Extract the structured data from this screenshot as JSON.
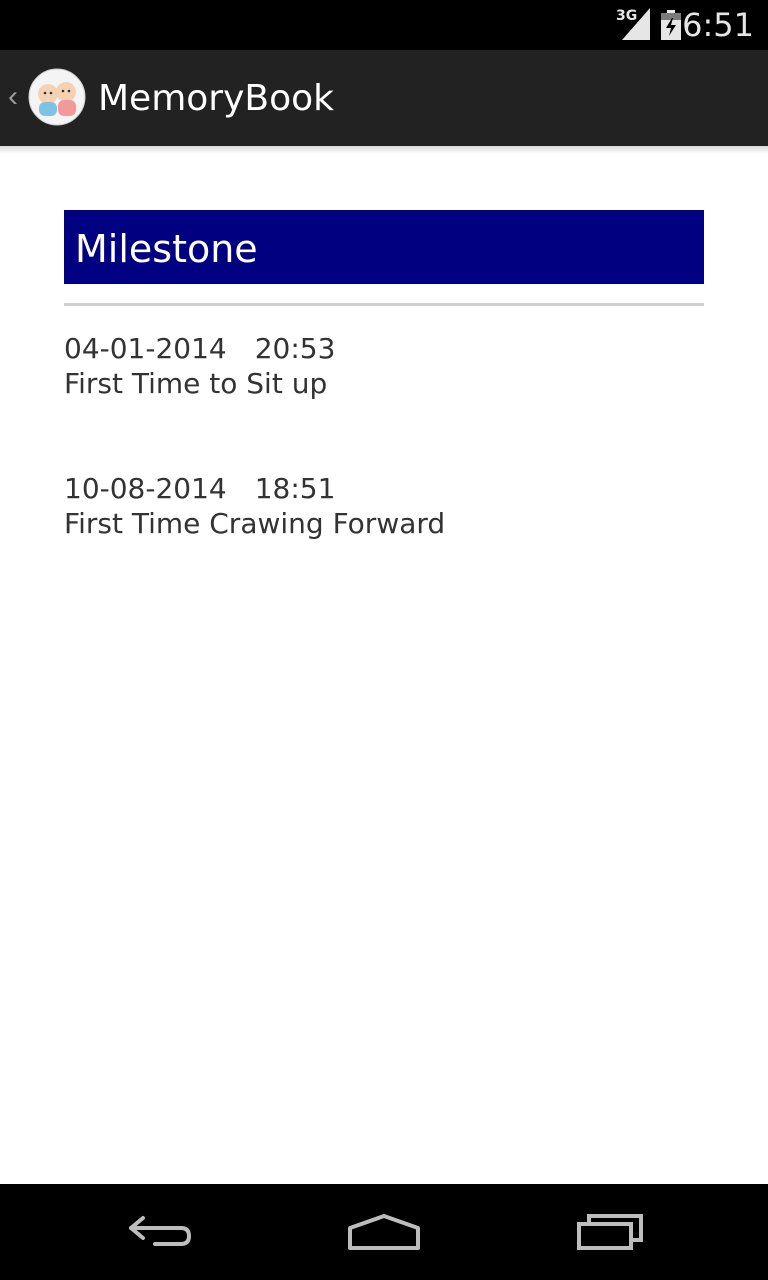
{
  "status_bar": {
    "network_type": "3G",
    "time": "6:51",
    "icons": [
      "signal-icon",
      "battery-icon"
    ]
  },
  "action_bar": {
    "title": "MemoryBook",
    "icons": [
      "up-caret-icon",
      "app-logo-icon"
    ]
  },
  "section": {
    "header": "Milestone",
    "header_color": "#000080"
  },
  "milestones": [
    {
      "date": "04-01-2014",
      "time": "20:53",
      "title": "First Time to Sit up"
    },
    {
      "date": "10-08-2014",
      "time": "18:51",
      "title": "First Time Crawing Forward"
    }
  ],
  "nav_bar": {
    "icons": [
      "back-icon",
      "home-icon",
      "recent-apps-icon"
    ]
  }
}
